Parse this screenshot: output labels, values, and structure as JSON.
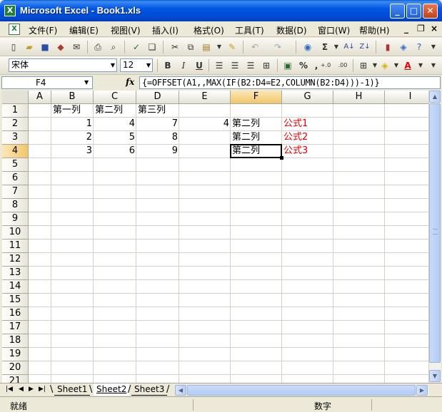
{
  "window": {
    "title": "Microsoft Excel - Book1.xls",
    "app_icon_glyph": "X"
  },
  "menu": [
    "文件(F)",
    "编辑(E)",
    "视图(V)",
    "插入(I)",
    "格式(O)",
    "工具(T)",
    "数据(D)",
    "窗口(W)",
    "帮助(H)"
  ],
  "mdi_controls": {
    "minimize": "_",
    "restore": "❐",
    "close": "×"
  },
  "toolbar_standard_icons": [
    "new-icon",
    "open-icon",
    "save-icon",
    "permission-icon",
    "email-icon",
    "print-icon",
    "print-preview-icon",
    "spelling-icon",
    "research-icon",
    "cut-icon",
    "copy-icon",
    "paste-icon",
    "format-painter-icon",
    "undo-icon",
    "redo-icon",
    "hyperlink-icon",
    "autosum-icon",
    "sort-ascending-icon",
    "sort-descending-icon",
    "chart-wizard-icon",
    "drawing-icon",
    "help-icon"
  ],
  "formatting": {
    "font_name": "宋体",
    "font_size": "12",
    "bold": "B",
    "italic": "I",
    "underline": "U",
    "percent": "%",
    "comma": ",",
    "inc_decimal": "+.0",
    "dec_decimal": ".00"
  },
  "autosum_glyph": "Σ",
  "formula_bar": {
    "name_box": "F4",
    "fx_label": "fx",
    "formula": "{=OFFSET(A1,,MAX(IF(B2:D4=E2,COLUMN(B2:D4)))-1)}"
  },
  "columns": [
    "A",
    "B",
    "C",
    "D",
    "E",
    "F",
    "G",
    "H",
    "I"
  ],
  "rows": [
    "1",
    "2",
    "3",
    "4",
    "5",
    "6",
    "7",
    "8",
    "9",
    "10",
    "11",
    "12",
    "13",
    "14",
    "15",
    "16",
    "17",
    "18",
    "19",
    "20",
    "21"
  ],
  "cells": {
    "B1": "第一列",
    "C1": "第二列",
    "D1": "第三列",
    "B2": "1",
    "C2": "4",
    "D2": "7",
    "E2": "4",
    "F2": "第二列",
    "G2": "公式1",
    "B3": "2",
    "C3": "5",
    "D3": "8",
    "F3": "第二列",
    "G3": "公式2",
    "B4": "3",
    "C4": "6",
    "D4": "9",
    "F4": "第二列",
    "G4": "公式3"
  },
  "active_cell": "F4",
  "accent_colors": {
    "formula_note": "#E00000",
    "selection_header": "#F2C66A",
    "titlebar": "#0055E5"
  },
  "sheet_tabs": [
    "Sheet1",
    "Sheet2",
    "Sheet3"
  ],
  "active_sheet": "Sheet2",
  "status": {
    "left": "就绪",
    "right": "数字"
  }
}
